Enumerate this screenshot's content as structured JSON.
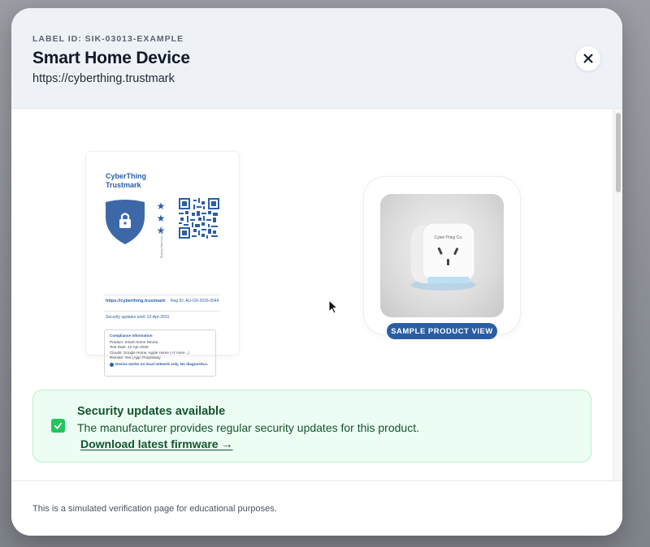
{
  "header": {
    "label_id": "LABEL ID: SIK-03013-EXAMPLE",
    "title": "Smart Home Device",
    "url": "https://cyberthing.trustmark"
  },
  "icons": {
    "close": "close-icon",
    "shield": "shield-lock-icon",
    "check": "check-icon",
    "cursor": "mouse-pointer-icon"
  },
  "label_card": {
    "brand_line1": "CyberThing",
    "brand_line2": "Trustmark",
    "stars": [
      "★",
      "★",
      "★"
    ],
    "vertical_text": "Cyber Security Rating",
    "url": "https://cyberthing.trustmark",
    "reg_id": "Reg ID: AU-CR-2026-0044",
    "security_until": "Security updates until: 12-Apr-2031",
    "compliance": {
      "title": "Compliance Information",
      "product": "Product: Smart Home Device",
      "test_date": "Test Date: 12-Apr-2026",
      "clouds": "Clouds: Google Home, Apple Home (+2 more...)",
      "remote": "Remote: Yes | App: Proprietary",
      "note": "Device works on local network only. No diagnostics."
    }
  },
  "product": {
    "device_brand": "CyberThing Co.",
    "badge": "SAMPLE PRODUCT VIEW"
  },
  "security_banner": {
    "title": "Security updates available",
    "description": "The manufacturer provides regular security updates for this product.",
    "link": "Download latest firmware →"
  },
  "footer": {
    "text": "This is a simulated verification page for educational purposes."
  },
  "colors": {
    "brand_blue": "#2b5fa6",
    "success_bg": "#ecfdf3",
    "success_text": "#14532d",
    "success_icon": "#22c55e"
  }
}
